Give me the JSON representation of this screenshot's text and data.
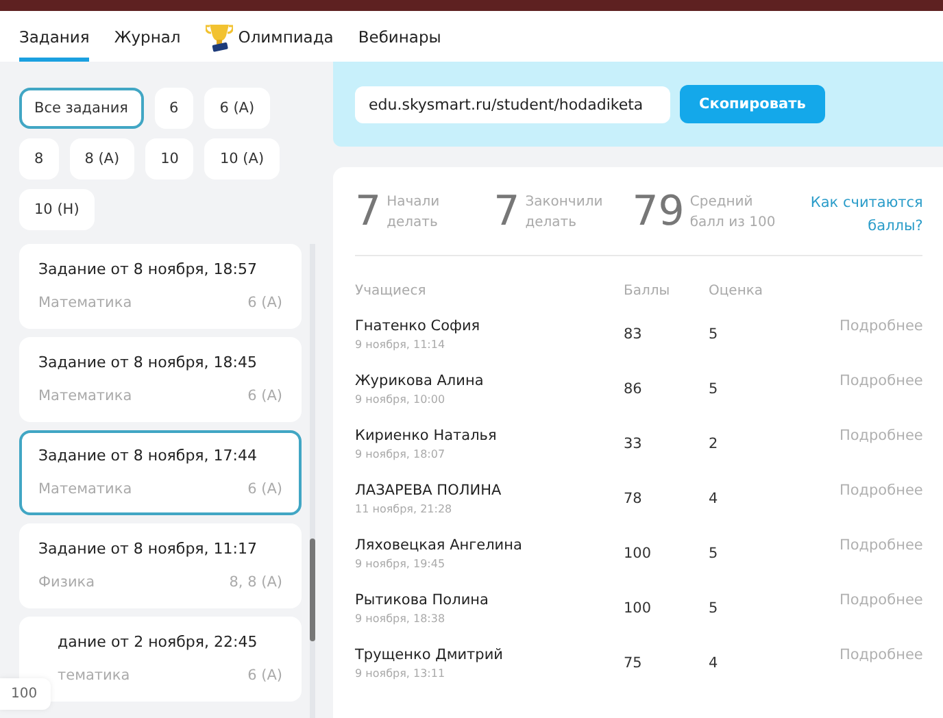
{
  "nav": {
    "tabs": [
      {
        "label": "Задания",
        "selected": true,
        "kind": "plain"
      },
      {
        "label": "Журнал",
        "selected": false,
        "kind": "plain"
      },
      {
        "label": "Олимпиада",
        "selected": false,
        "kind": "trophy"
      },
      {
        "label": "Вебинары",
        "selected": false,
        "kind": "plain"
      }
    ]
  },
  "filters": [
    {
      "label": "Все задания",
      "selected": true
    },
    {
      "label": "6",
      "selected": false
    },
    {
      "label": "6 (A)",
      "selected": false
    },
    {
      "label": "8",
      "selected": false
    },
    {
      "label": "8 (A)",
      "selected": false
    },
    {
      "label": "10",
      "selected": false
    },
    {
      "label": "10 (A)",
      "selected": false
    },
    {
      "label": "10 (H)",
      "selected": false
    }
  ],
  "assignments": [
    {
      "title": "Задание от 8 ноября, 18:57",
      "subject": "Математика",
      "classes": "6 (A)",
      "selected": false
    },
    {
      "title": "Задание от 8 ноября, 18:45",
      "subject": "Математика",
      "classes": "6 (A)",
      "selected": false
    },
    {
      "title": "Задание от 8 ноября, 17:44",
      "subject": "Математика",
      "classes": "6 (A)",
      "selected": true
    },
    {
      "title": "Задание от 8 ноября, 11:17",
      "subject": "Физика",
      "classes": "8, 8 (A)",
      "selected": false
    },
    {
      "title": "дание от 2 ноября, 22:45",
      "subject": "тематика",
      "classes": "6 (A)",
      "selected": false
    }
  ],
  "floating_label": "100",
  "share": {
    "link": "edu.skysmart.ru/student/hodadiketa",
    "button": "Скопировать"
  },
  "stats": [
    {
      "value": "7",
      "label": "Начали делать"
    },
    {
      "value": "7",
      "label": "Закончили делать"
    },
    {
      "value": "79",
      "label": "Средний балл из 100"
    }
  ],
  "help_link": "Как считаются баллы?",
  "table": {
    "columns": [
      "Учащиеся",
      "Баллы",
      "Оценка"
    ],
    "rows": [
      {
        "name": "Гнатенко София",
        "date": "9 ноября, 11:14",
        "score": "83",
        "grade": "5",
        "action": "Подробнее"
      },
      {
        "name": "Журикова Алина",
        "date": "9 ноября, 10:00",
        "score": "86",
        "grade": "5",
        "action": "Подробнее"
      },
      {
        "name": "Кириенко Наталья",
        "date": "9 ноября, 18:07",
        "score": "33",
        "grade": "2",
        "action": "Подробнее"
      },
      {
        "name": "ЛАЗАРЕВА ПОЛИНА",
        "date": "11 ноября, 21:28",
        "score": "78",
        "grade": "4",
        "action": "Подробнее"
      },
      {
        "name": "Ляховецкая Ангелина",
        "date": "9 ноября, 19:45",
        "score": "100",
        "grade": "5",
        "action": "Подробнее"
      },
      {
        "name": "Рытикова Полина",
        "date": "9 ноября, 18:38",
        "score": "100",
        "grade": "5",
        "action": "Подробнее"
      },
      {
        "name": "Трущенко Дмитрий",
        "date": "9 ноября, 13:11",
        "score": "75",
        "grade": "4",
        "action": "Подробнее"
      }
    ]
  }
}
